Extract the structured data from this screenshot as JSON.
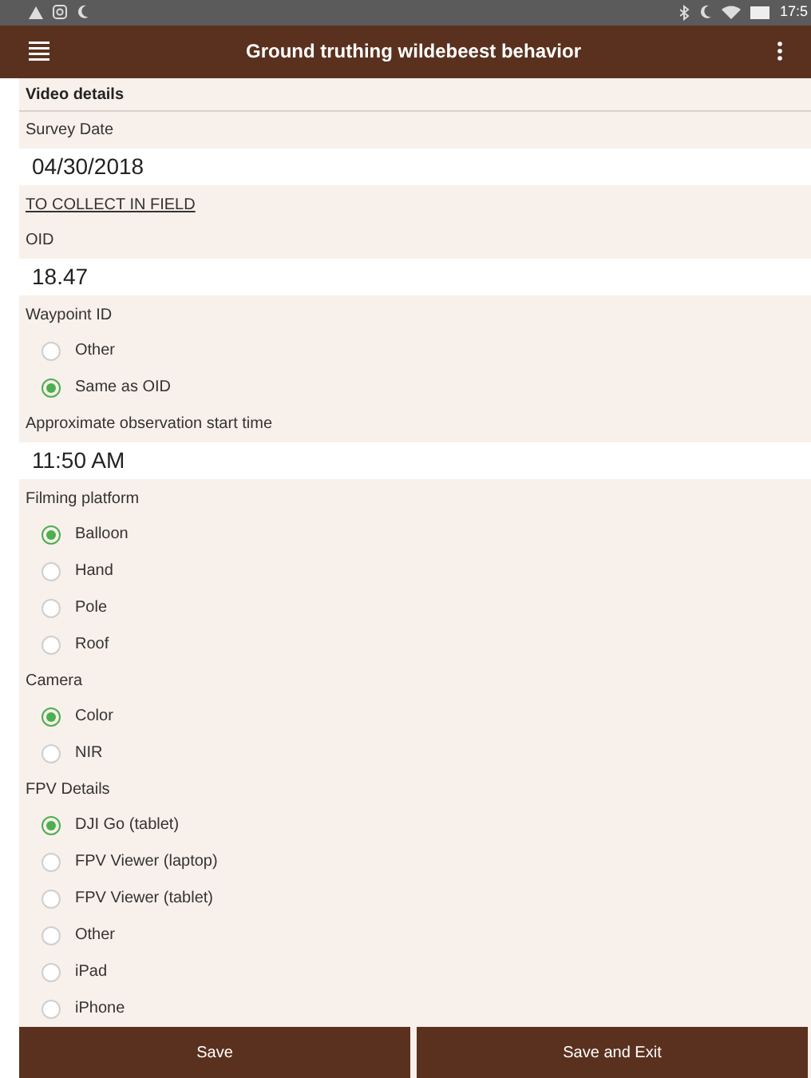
{
  "status_bar": {
    "time": "17:5"
  },
  "header": {
    "title": "Ground truthing wildebeest behavior"
  },
  "form": [
    {
      "kind": "section",
      "text": "Video details"
    },
    {
      "kind": "label",
      "text": "Survey Date"
    },
    {
      "kind": "field",
      "value": "04/30/2018"
    },
    {
      "kind": "link",
      "text": "TO COLLECT IN FIELD"
    },
    {
      "kind": "label",
      "text": "OID"
    },
    {
      "kind": "field",
      "value": "18.47"
    },
    {
      "kind": "label",
      "text": "Waypoint ID"
    },
    {
      "kind": "radios",
      "options": [
        {
          "label": "Other",
          "selected": false
        },
        {
          "label": "Same as OID",
          "selected": true
        }
      ]
    },
    {
      "kind": "label",
      "text": "Approximate observation start time"
    },
    {
      "kind": "field",
      "value": "11:50 AM"
    },
    {
      "kind": "label",
      "text": "Filming platform"
    },
    {
      "kind": "radios",
      "options": [
        {
          "label": "Balloon",
          "selected": true
        },
        {
          "label": "Hand",
          "selected": false
        },
        {
          "label": "Pole",
          "selected": false
        },
        {
          "label": "Roof",
          "selected": false
        }
      ]
    },
    {
      "kind": "label",
      "text": "Camera"
    },
    {
      "kind": "radios",
      "options": [
        {
          "label": "Color",
          "selected": true
        },
        {
          "label": "NIR",
          "selected": false
        }
      ]
    },
    {
      "kind": "label",
      "text": "FPV Details"
    },
    {
      "kind": "radios",
      "options": [
        {
          "label": "DJI Go (tablet)",
          "selected": true
        },
        {
          "label": "FPV Viewer (laptop)",
          "selected": false
        },
        {
          "label": "FPV Viewer (tablet)",
          "selected": false
        },
        {
          "label": "Other",
          "selected": false
        },
        {
          "label": "iPad",
          "selected": false
        },
        {
          "label": "iPhone",
          "selected": false
        }
      ]
    }
  ],
  "buttons": [
    "Save",
    "Save and Exit"
  ]
}
